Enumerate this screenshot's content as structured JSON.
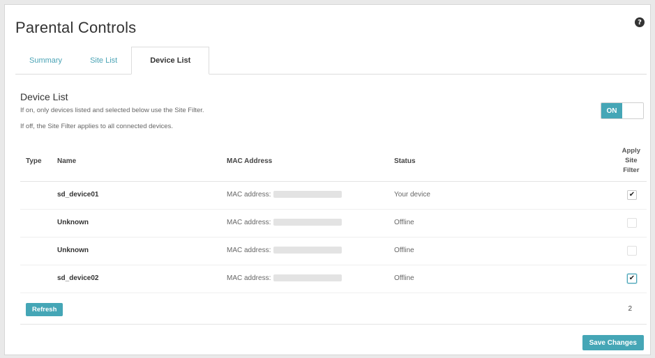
{
  "page": {
    "title": "Parental Controls"
  },
  "header": {
    "help_icon_glyph": "?"
  },
  "tabs": [
    {
      "label": "Summary",
      "active": false
    },
    {
      "label": "Site List",
      "active": false
    },
    {
      "label": "Device List",
      "active": true
    }
  ],
  "section": {
    "title": "Device List",
    "desc_on": "If on, only devices listed and selected below use the Site Filter.",
    "desc_off": "If off, the Site Filter applies to all connected devices.",
    "toggle_label": "ON"
  },
  "table": {
    "headers": {
      "type": "Type",
      "name": "Name",
      "mac": "MAC Address",
      "status": "Status",
      "apply_line1": "Apply",
      "apply_line2": "Site",
      "apply_line3": "Filter"
    },
    "rows": [
      {
        "name": "sd_device01",
        "mac_prefix": "MAC address:",
        "status": "Your device",
        "checked": true
      },
      {
        "name": "Unknown",
        "mac_prefix": "MAC address:",
        "status": "Offline",
        "checked": false
      },
      {
        "name": "Unknown",
        "mac_prefix": "MAC address:",
        "status": "Offline",
        "checked": false
      },
      {
        "name": "sd_device02",
        "mac_prefix": "MAC address:",
        "status": "Offline",
        "checked": true
      }
    ]
  },
  "footer": {
    "refresh_label": "Refresh",
    "selected_count": "2",
    "save_label": "Save Changes"
  },
  "colors": {
    "accent": "#45a6b6",
    "tab_link": "#4aa3b5"
  }
}
